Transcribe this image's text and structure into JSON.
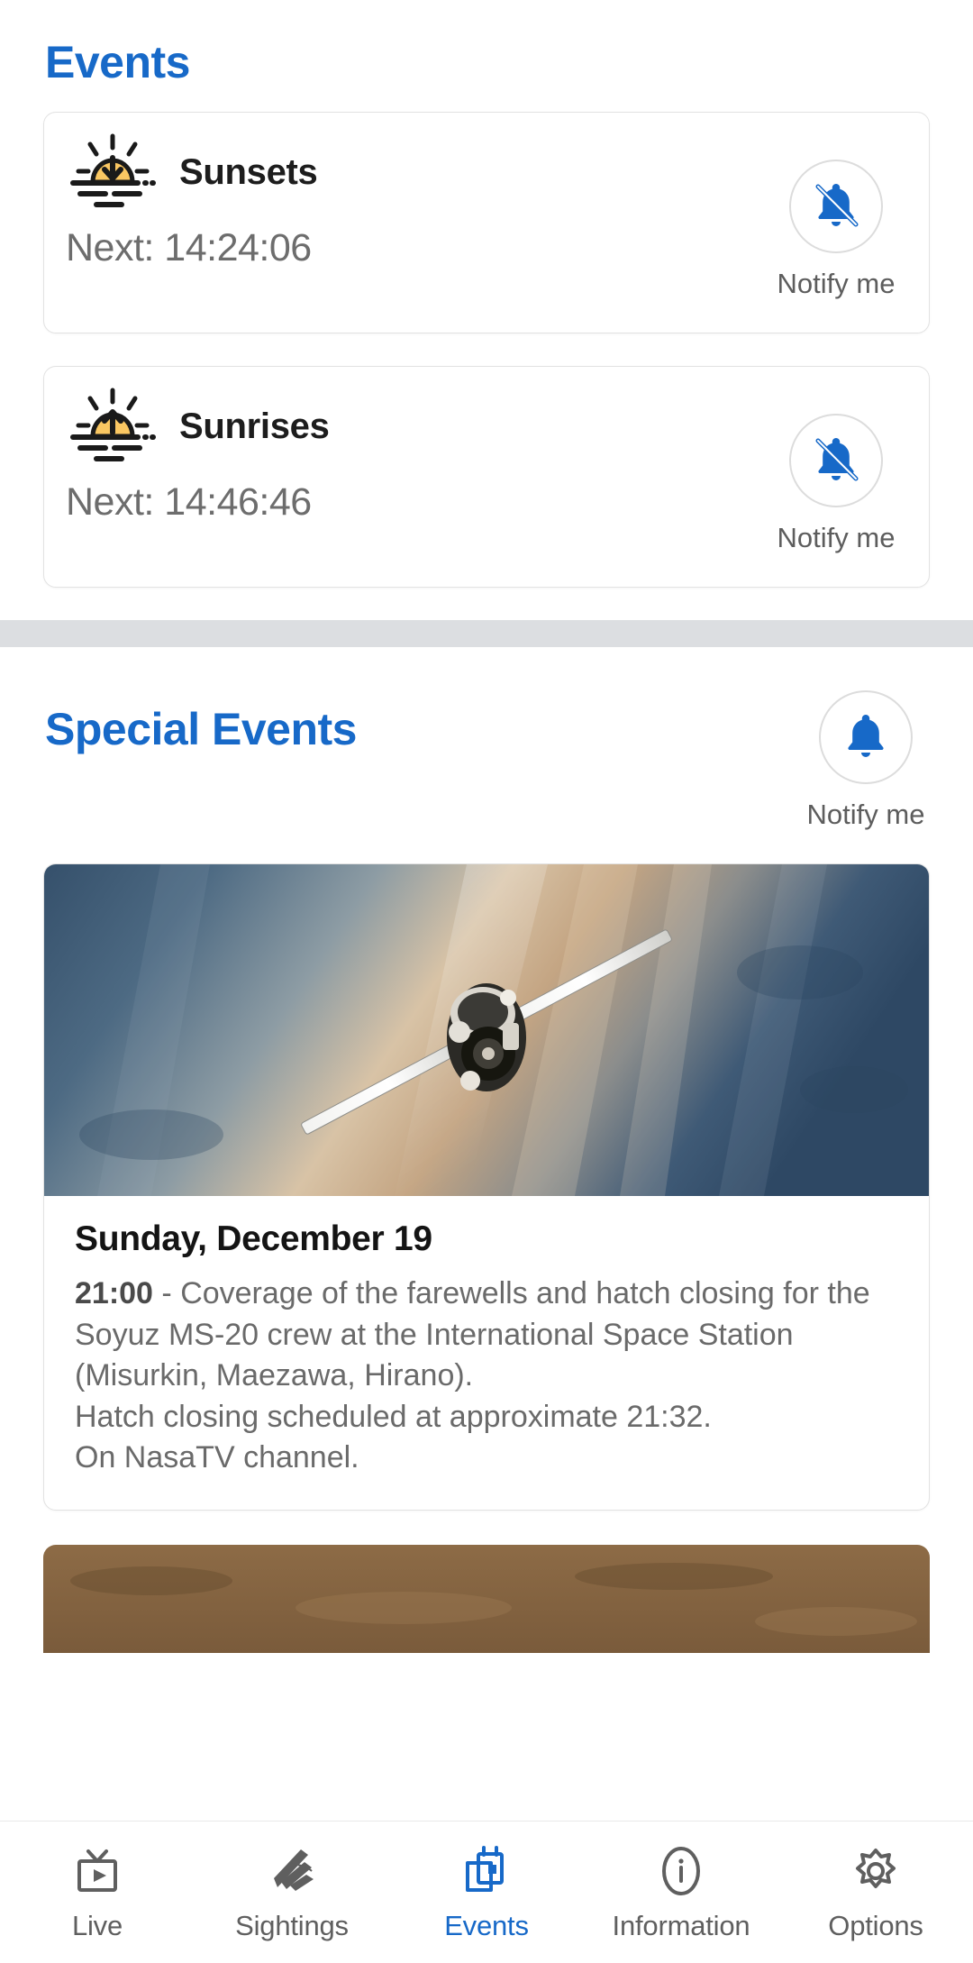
{
  "colors": {
    "accent": "#1769c8",
    "sun_fill": "#fac762",
    "muted_text": "#6d6d6d",
    "divider_band": "#dcdee1",
    "card_border": "#e2e2e2"
  },
  "header": {
    "title": "Events"
  },
  "events": [
    {
      "name": "Sunsets",
      "icon": "sunset-icon",
      "next_label": "Next: 14:24:06",
      "notify": {
        "label": "Notify me",
        "icon": "bell-off-icon",
        "enabled": false
      }
    },
    {
      "name": "Sunrises",
      "icon": "sunrise-icon",
      "next_label": "Next: 14:46:46",
      "notify": {
        "label": "Notify me",
        "icon": "bell-off-icon",
        "enabled": false
      }
    }
  ],
  "special": {
    "title": "Special Events",
    "notify": {
      "label": "Notify me",
      "icon": "bell-icon",
      "enabled": true
    },
    "cards": [
      {
        "image": "soyuz-spacecraft-over-earth-photo",
        "date": "Sunday, December 19",
        "time": "21:00",
        "separator": " - ",
        "description": "Coverage of the farewells and hatch closing for the Soyuz MS-20 crew at the International Space Station (Misurkin, Maezawa, Hirano).\nHatch closing scheduled at approximate 21:32.\nOn NasaTV channel."
      }
    ],
    "next_card_image": "terrain-photo-partial"
  },
  "bottom_nav": {
    "active": "Events",
    "items": [
      {
        "label": "Live",
        "icon": "tv-icon"
      },
      {
        "label": "Sightings",
        "icon": "wing-icon"
      },
      {
        "label": "Events",
        "icon": "calendar-icon"
      },
      {
        "label": "Information",
        "icon": "info-circle-icon"
      },
      {
        "label": "Options",
        "icon": "gear-icon"
      }
    ]
  }
}
